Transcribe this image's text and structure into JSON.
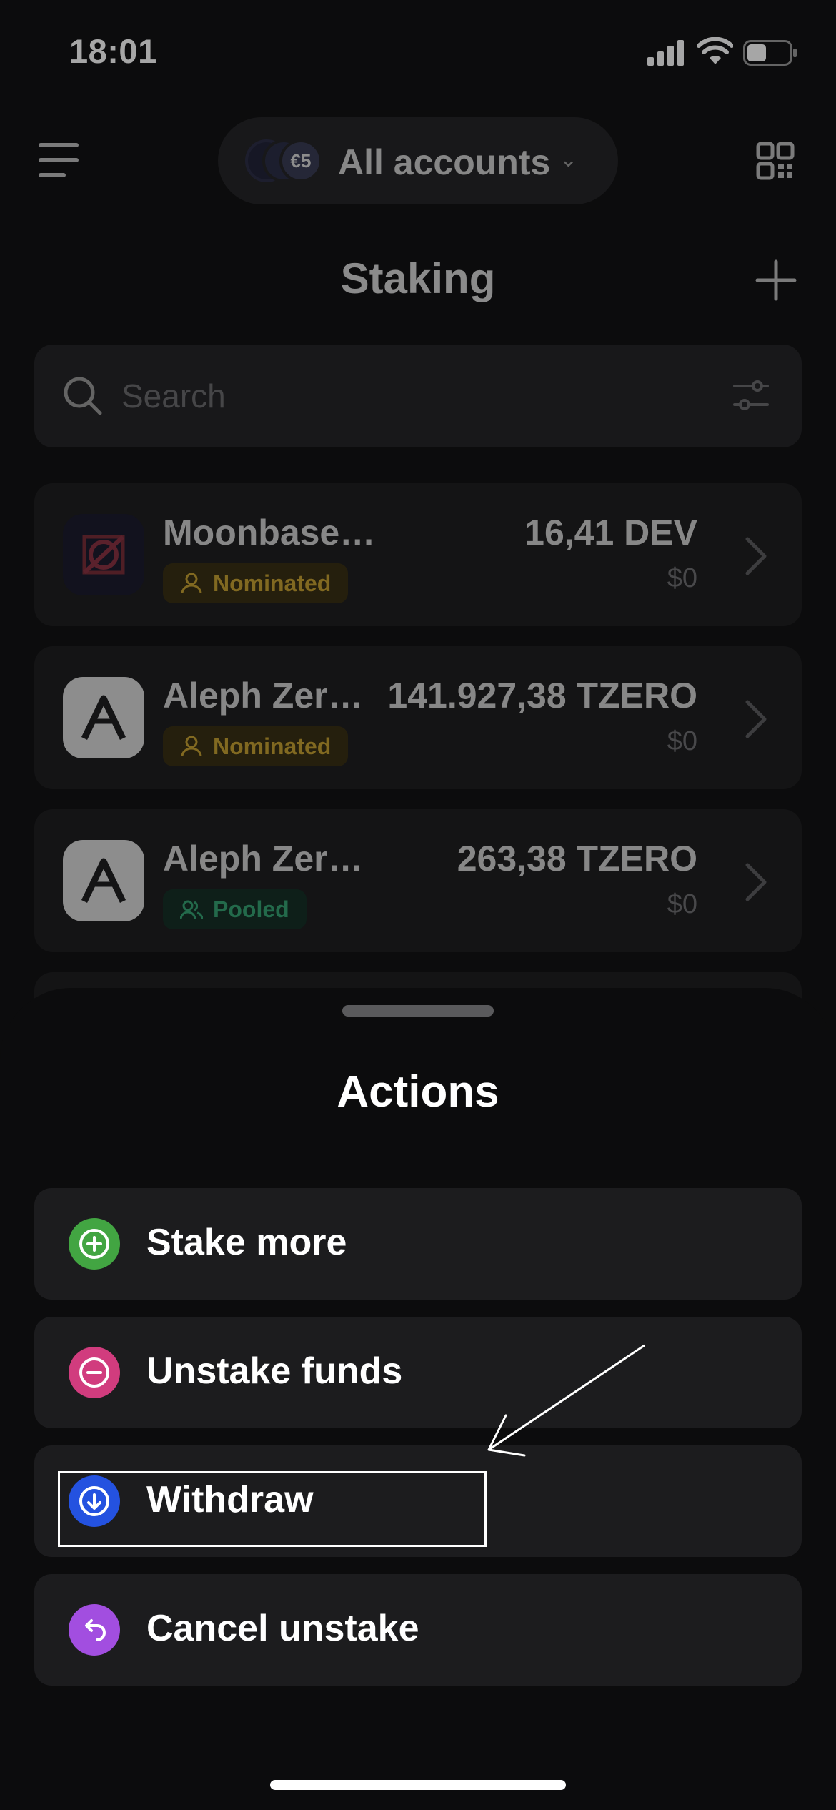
{
  "status_bar": {
    "time": "18:01"
  },
  "header": {
    "account_selector_label": "All accounts",
    "avatar_badge": "€5",
    "page_title": "Staking"
  },
  "search": {
    "placeholder": "Search",
    "value": ""
  },
  "staking_items": [
    {
      "chain": "Moonbase Alpha",
      "status": "Nominated",
      "amount": "16,41 DEV",
      "fiat": "$0"
    },
    {
      "chain": "Aleph Zero…",
      "status": "Nominated",
      "amount": "141.927,38 TZERO",
      "fiat": "$0"
    },
    {
      "chain": "Aleph Zero Test…",
      "status": "Pooled",
      "amount": "263,38 TZERO",
      "fiat": "$0"
    }
  ],
  "actions_sheet": {
    "title": "Actions",
    "actions": [
      {
        "label": "Stake more",
        "icon": "plus-circle-icon",
        "color": "#42a542"
      },
      {
        "label": "Unstake funds",
        "icon": "minus-circle-icon",
        "color": "#d13c7e"
      },
      {
        "label": "Withdraw",
        "icon": "arrow-down-circle-icon",
        "color": "#2452e0"
      },
      {
        "label": "Cancel unstake",
        "icon": "undo-icon",
        "color": "#a24ee0"
      }
    ]
  },
  "colors": {
    "background": "#131314",
    "sheet": "#0c0c0d",
    "card": "#1c1c1e",
    "nominated": "#c7a233",
    "pooled": "#36a373"
  }
}
